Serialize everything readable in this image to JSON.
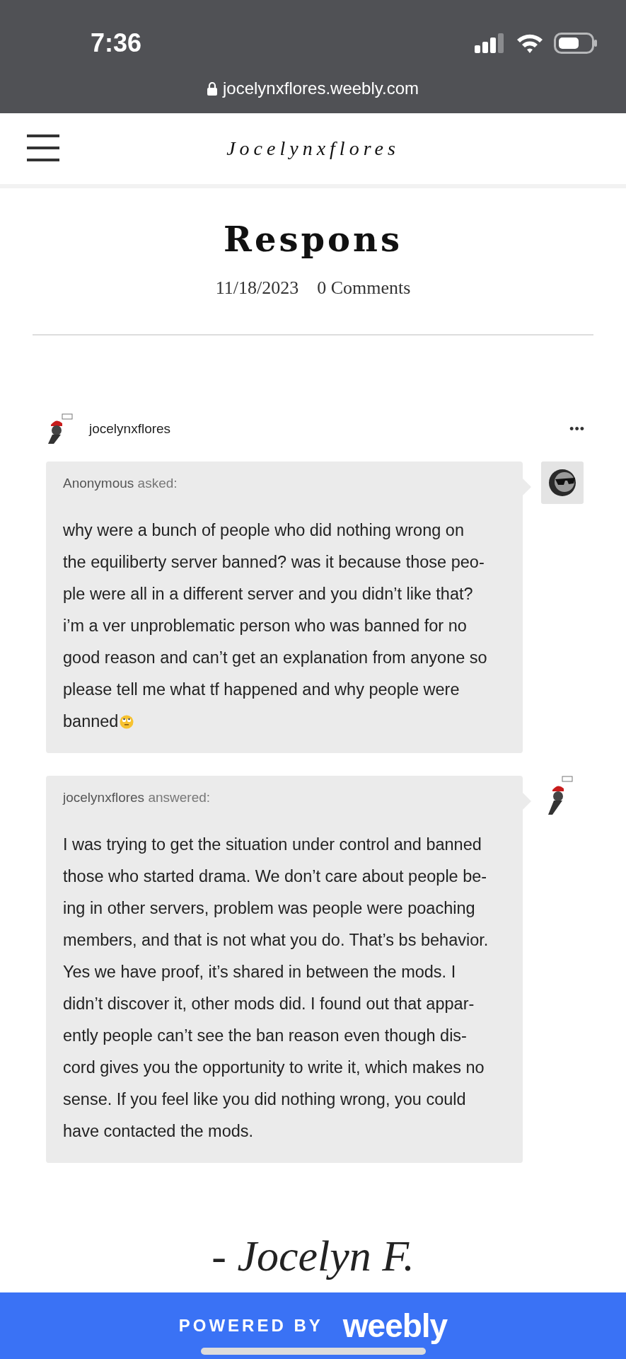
{
  "status_bar": {
    "time": "7:36",
    "url": "jocelynxflores.weebly.com"
  },
  "site_header": {
    "site_title": "Jocelynxflores"
  },
  "post": {
    "title": "Respons",
    "date": "11/18/2023",
    "comments": "0 Comments",
    "blog": {
      "name": "jocelynxflores",
      "menu": "•••"
    },
    "messages": [
      {
        "kind": "ask",
        "author": "Anonymous",
        "verb": "asked:",
        "lines": [
          "why were a bunch of people who did nothing wrong on",
          "the equiliberty server banned? was it because those peo-",
          "ple were all in a different server and you didn’t like that?",
          "i’m a ver unproblematic person who was banned for no",
          "good reason and can’t get an explanation from anyone so",
          "please tell me what tf happened and why people were",
          "banned"
        ],
        "emoji": true
      },
      {
        "kind": "answer",
        "author": "jocelynxflores",
        "verb": "answered:",
        "lines": [
          "I was trying to get the situation under control and banned",
          "those who started drama. We don’t care about people be-",
          "ing in other servers, problem was people were poaching",
          "members, and that is not what you do. That’s bs behavior.",
          "Yes we have proof, it’s shared in between the mods. I",
          "didn’t discover it, other mods did. I found out that appar-",
          "ently people can’t see the ban reason even though dis-",
          "cord gives you the opportunity to write it, which makes no",
          "sense. If you feel like you did nothing wrong, you could",
          "have contacted the mods."
        ],
        "emoji": false
      }
    ],
    "signature": "- Jocelyn F."
  },
  "footer": {
    "powered_by": "POWERED BY",
    "brand": "weebly"
  }
}
